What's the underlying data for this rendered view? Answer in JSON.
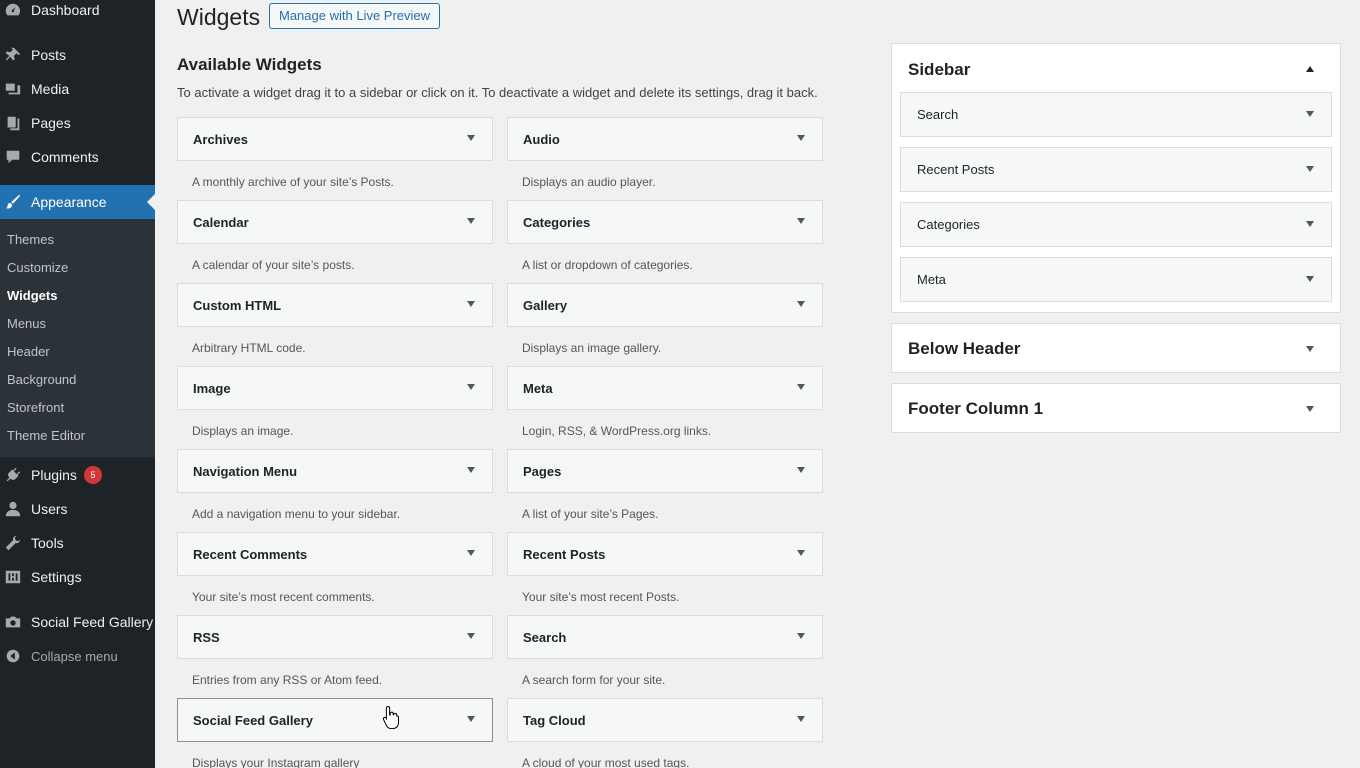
{
  "admin_menu": {
    "items": [
      {
        "label": "Dashboard",
        "icon": "dashboard-icon"
      },
      {
        "label": "Posts",
        "icon": "pushpin-icon"
      },
      {
        "label": "Media",
        "icon": "media-icon"
      },
      {
        "label": "Pages",
        "icon": "pages-icon"
      },
      {
        "label": "Comments",
        "icon": "comment-icon"
      },
      {
        "label": "Appearance",
        "icon": "paintbrush-icon",
        "current": true
      },
      {
        "label": "Plugins",
        "icon": "plugin-icon",
        "badge": "5"
      },
      {
        "label": "Users",
        "icon": "user-icon"
      },
      {
        "label": "Tools",
        "icon": "wrench-icon"
      },
      {
        "label": "Settings",
        "icon": "settings-icon"
      },
      {
        "label": "Social Feed Gallery",
        "icon": "camera-icon"
      },
      {
        "label": "Collapse menu",
        "icon": "collapse-icon"
      }
    ],
    "submenu": [
      "Themes",
      "Customize",
      "Widgets",
      "Menus",
      "Header",
      "Background",
      "Storefront",
      "Theme Editor"
    ],
    "submenu_current": "Widgets"
  },
  "header": {
    "title": "Widgets",
    "live_preview_label": "Manage with Live Preview"
  },
  "available": {
    "title": "Available Widgets",
    "description": "To activate a widget drag it to a sidebar or click on it. To deactivate a widget and delete its settings, drag it back.",
    "widgets": [
      {
        "name": "Archives",
        "desc": "A monthly archive of your site’s Posts."
      },
      {
        "name": "Audio",
        "desc": "Displays an audio player."
      },
      {
        "name": "Calendar",
        "desc": "A calendar of your site’s posts."
      },
      {
        "name": "Categories",
        "desc": "A list or dropdown of categories."
      },
      {
        "name": "Custom HTML",
        "desc": "Arbitrary HTML code."
      },
      {
        "name": "Gallery",
        "desc": "Displays an image gallery."
      },
      {
        "name": "Image",
        "desc": "Displays an image."
      },
      {
        "name": "Meta",
        "desc": "Login, RSS, & WordPress.org links."
      },
      {
        "name": "Navigation Menu",
        "desc": "Add a navigation menu to your sidebar."
      },
      {
        "name": "Pages",
        "desc": "A list of your site’s Pages."
      },
      {
        "name": "Recent Comments",
        "desc": "Your site’s most recent comments."
      },
      {
        "name": "Recent Posts",
        "desc": "Your site’s most recent Posts."
      },
      {
        "name": "RSS",
        "desc": "Entries from any RSS or Atom feed."
      },
      {
        "name": "Search",
        "desc": "A search form for your site."
      },
      {
        "name": "Social Feed Gallery",
        "desc": "Displays your Instagram gallery"
      },
      {
        "name": "Tag Cloud",
        "desc": "A cloud of your most used tags."
      }
    ]
  },
  "sidebars": [
    {
      "title": "Sidebar",
      "expanded": true,
      "widgets": [
        "Search",
        "Recent Posts",
        "Categories",
        "Meta"
      ]
    },
    {
      "title": "Below Header",
      "expanded": false,
      "widgets": []
    },
    {
      "title": "Footer Column 1",
      "expanded": false,
      "widgets": []
    }
  ],
  "colors": {
    "menu_bg": "#1d2327",
    "submenu_bg": "#2c3338",
    "accent": "#2271b1",
    "badge": "#d63638"
  }
}
